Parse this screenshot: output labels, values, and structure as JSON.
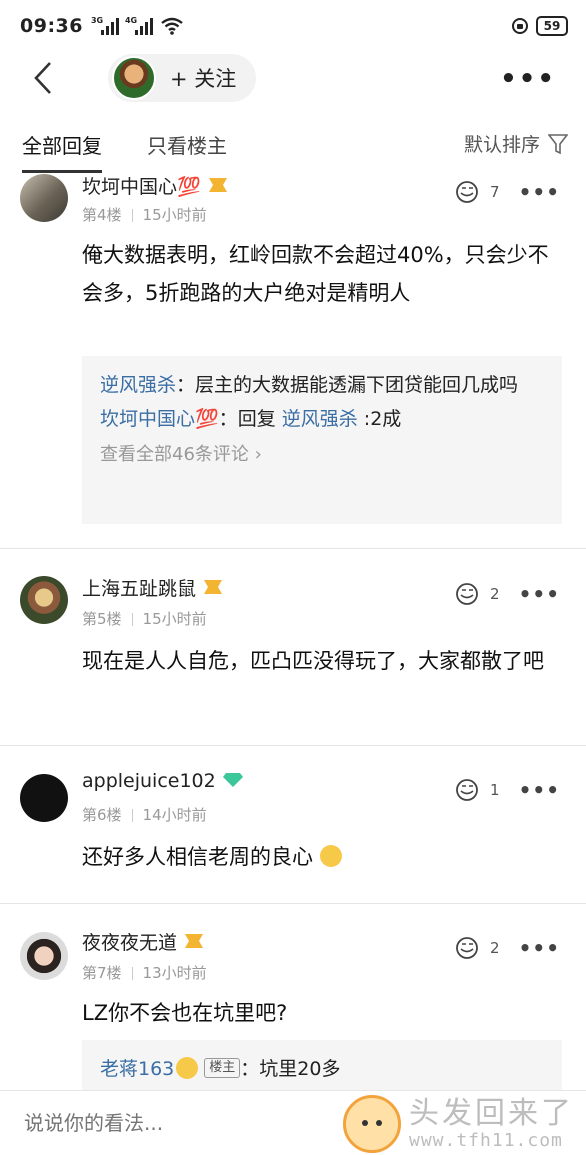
{
  "status": {
    "time": "09:36",
    "net1": "3G",
    "net2": "4G",
    "battery": "59"
  },
  "nav": {
    "follow_label": "+ 关注",
    "more": "•••"
  },
  "tabs": {
    "all": "全部回复",
    "op_only": "只看楼主",
    "sort": "默认排序"
  },
  "comments": [
    {
      "name": "坎坷中国心💯",
      "floor": "第4楼",
      "time": "15小时前",
      "likes": "7",
      "body": "俺大数据表明，红岭回款不会超过40%，只会少不会多，5折跑路的大户绝对是精明人",
      "replies": [
        {
          "user": "逆风强杀",
          "sep": "：",
          "text": "层主的大数据能透漏下团贷能回几成吗"
        },
        {
          "user": "坎坷中国心💯",
          "sep": "：",
          "prefix": "回复 ",
          "to": "逆风强杀",
          "text": " :2成"
        }
      ],
      "view_all": "查看全部46条评论 ›"
    },
    {
      "name": "上海五趾跳鼠",
      "floor": "第5楼",
      "time": "15小时前",
      "likes": "2",
      "body": "现在是人人自危，匹凸匹没得玩了，大家都散了吧"
    },
    {
      "name": "applejuice102",
      "floor": "第6楼",
      "time": "14小时前",
      "likes": "1",
      "body": "还好多人相信老周的良心"
    },
    {
      "name": "夜夜夜无道",
      "floor": "第7楼",
      "time": "13小时前",
      "likes": "2",
      "body": "LZ你不会也在坑里吧?",
      "reply_user": "老蒋163",
      "reply_tag": "楼主",
      "reply_text": "：坑里20多"
    }
  ],
  "input": {
    "placeholder": "说说你的看法..."
  },
  "watermark": {
    "text": "头发回来了",
    "url": "www.tfh11.com"
  }
}
